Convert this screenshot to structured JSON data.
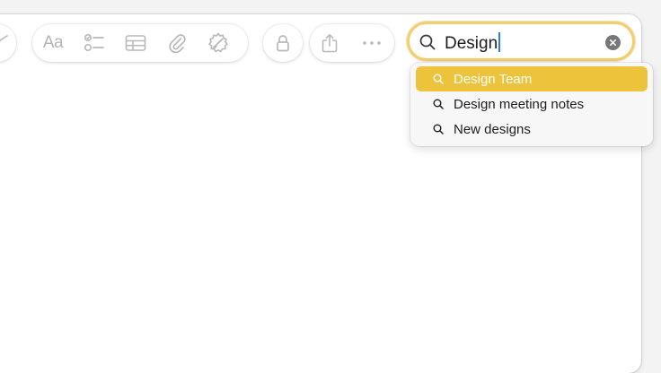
{
  "toolbar": {
    "format_label": "Aa",
    "buttons": [
      "compose-icon",
      "format-text-icon",
      "checklist-icon",
      "table-icon",
      "attachment-icon",
      "collaborate-icon",
      "lock-icon",
      "share-icon",
      "more-icon"
    ]
  },
  "search": {
    "value": "Design",
    "suggestions": [
      {
        "label": "Design Team",
        "selected": true
      },
      {
        "label": "Design meeting notes",
        "selected": false
      },
      {
        "label": "New designs",
        "selected": false
      }
    ]
  },
  "colors": {
    "accent": "#ecc33a",
    "focus_ring": "#f2cf6d",
    "icon_gray": "#b8b8b8",
    "caret": "#2a7af5"
  }
}
